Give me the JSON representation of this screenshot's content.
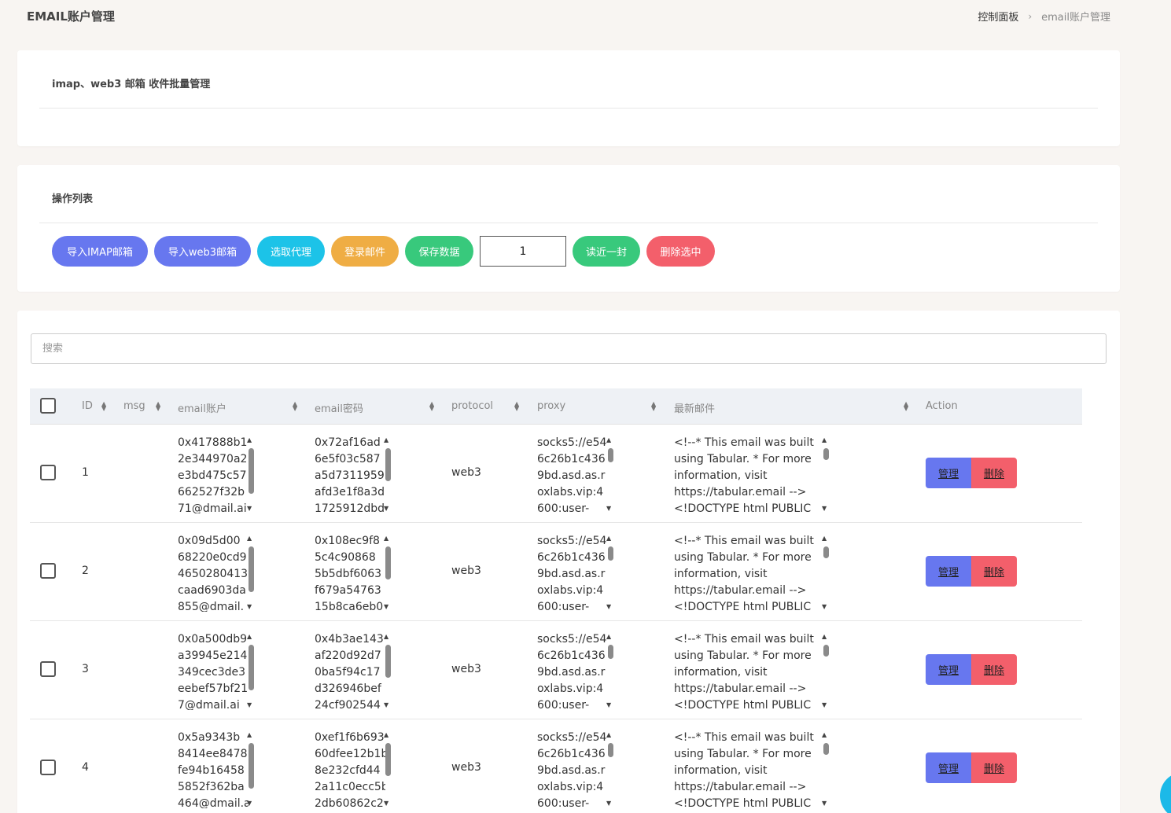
{
  "header": {
    "title": "EMAIL账户管理",
    "breadcrumb": {
      "home": "控制面板",
      "current": "email账户管理"
    }
  },
  "intro_card": {
    "title": "imap、web3 邮箱 收件批量管理"
  },
  "ops_card": {
    "title": "操作列表",
    "buttons": {
      "import_imap": "导入IMAP邮箱",
      "import_web3": "导入web3邮箱",
      "select_proxy": "选取代理",
      "login_mail": "登录邮件",
      "save_data": "保存数据",
      "count_value": "1",
      "read_recent": "读近一封",
      "delete_selected": "删除选中"
    }
  },
  "search": {
    "placeholder": "搜索"
  },
  "table": {
    "columns": {
      "id": "ID",
      "msg": "msg",
      "email": "email账户",
      "password": "email密码",
      "protocol": "protocol",
      "proxy": "proxy",
      "latest": "最新邮件",
      "action": "Action"
    },
    "manage_label": "管理",
    "delete_label": "删除",
    "rows": [
      {
        "id": "1",
        "email": "0x417888b1\n2e344970a2\ne3bd475c57\n662527f32b\n71@dmail.ai",
        "password": "0x72af16ad\n6e5f03c587\na5d7311959\nafd3e1f8a3d\n1725912dbd",
        "protocol": "web3",
        "proxy": "socks5://e54\n6c26b1c436\n9bd.asd.as.r\noxlabs.vip:4\n600:user-",
        "latest": "<!--* This email was built\nusing Tabular. * For more\ninformation, visit\nhttps://tabular.email -->\n<!DOCTYPE html PUBLIC"
      },
      {
        "id": "2",
        "email": "0x09d5d00\n68220e0cd9\n4650280413\ncaad6903da\n855@dmail.",
        "password": "0x108ec9f8\n5c4c90868\n5b5dbf6063\nf679a54763\n15b8ca6eb0",
        "protocol": "web3",
        "proxy": "socks5://e54\n6c26b1c436\n9bd.asd.as.r\noxlabs.vip:4\n600:user-",
        "latest": "<!--* This email was built\nusing Tabular. * For more\ninformation, visit\nhttps://tabular.email -->\n<!DOCTYPE html PUBLIC"
      },
      {
        "id": "3",
        "email": "0x0a500db9\na39945e214\n349cec3de3\neebef57bf21\n7@dmail.ai",
        "password": "0x4b3ae143\naf220d92d7\n0ba5f94c17\nd326946bef\n24cf902544",
        "protocol": "web3",
        "proxy": "socks5://e54\n6c26b1c436\n9bd.asd.as.r\noxlabs.vip:4\n600:user-",
        "latest": "<!--* This email was built\nusing Tabular. * For more\ninformation, visit\nhttps://tabular.email -->\n<!DOCTYPE html PUBLIC"
      },
      {
        "id": "4",
        "email": "0x5a9343b\n8414ee8478\nfe94b16458\n5852f362ba\n464@dmail.a",
        "password": "0xef1f6b693\n60dfee12b1b\n8e232cfd44\n2a11c0ecc5b\n2db60862c2",
        "protocol": "web3",
        "proxy": "socks5://e54\n6c26b1c436\n9bd.asd.as.r\noxlabs.vip:4\n600:user-",
        "latest": "<!--* This email was built\nusing Tabular. * For more\ninformation, visit\nhttps://tabular.email -->\n<!DOCTYPE html PUBLIC"
      }
    ]
  }
}
